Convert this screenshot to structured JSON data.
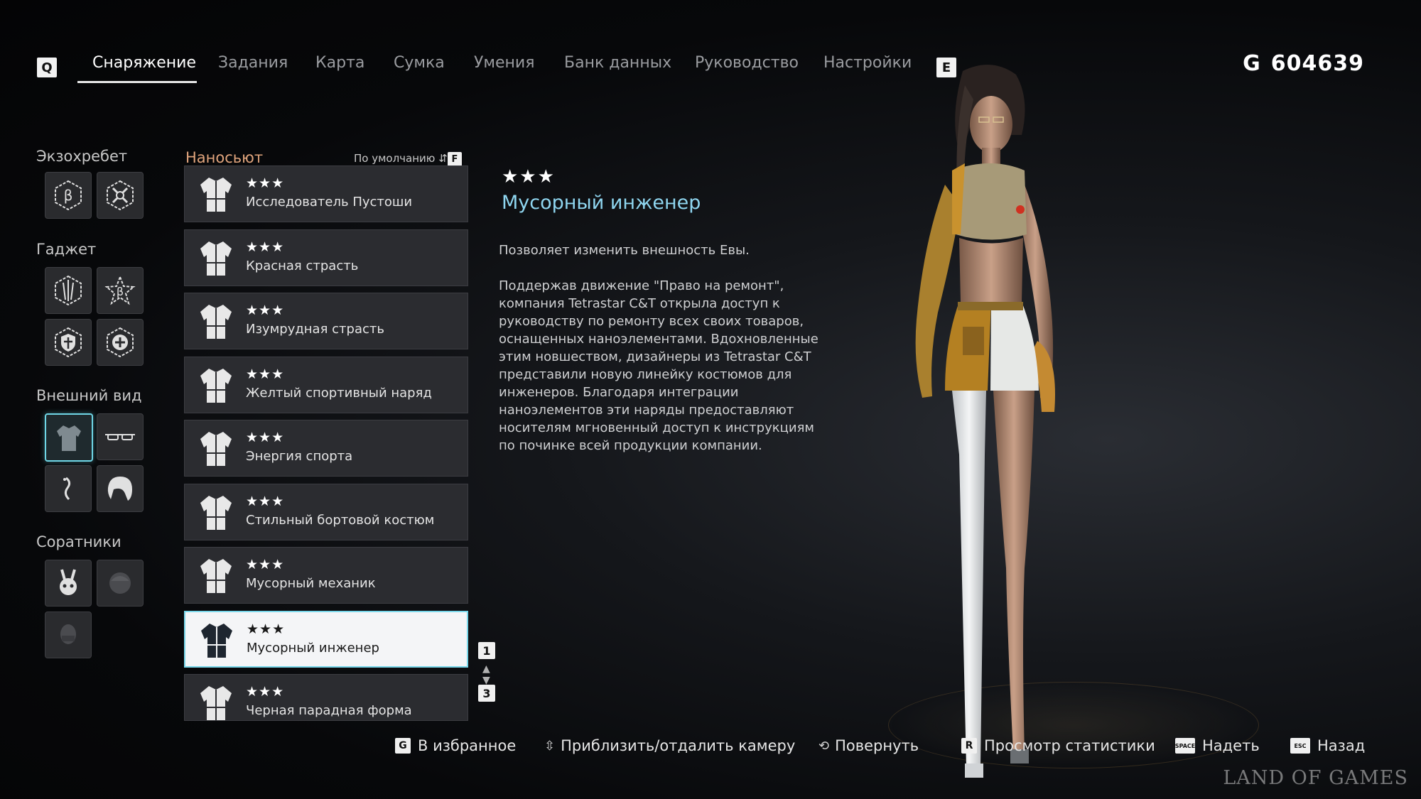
{
  "nav": {
    "prev_key": "Q",
    "next_key": "E",
    "tabs": [
      {
        "label": "Снаряжение"
      },
      {
        "label": "Задания"
      },
      {
        "label": "Карта"
      },
      {
        "label": "Сумка"
      },
      {
        "label": "Умения"
      },
      {
        "label": "Банк данных"
      },
      {
        "label": "Руководство"
      },
      {
        "label": "Настройки"
      }
    ],
    "active_tab": "Снаряжение"
  },
  "currency": {
    "symbol": "G",
    "amount": "604639"
  },
  "sidebar": {
    "exospine": "Экзохребет",
    "gadget": "Гаджет",
    "appearance": "Внешний вид",
    "companions": "Соратники"
  },
  "list": {
    "header": "Наносьют",
    "sort_label": "По умолчанию",
    "sort_key": "F",
    "items": [
      {
        "stars": "★★★",
        "name": "Исследователь Пустоши"
      },
      {
        "stars": "★★★",
        "name": "Красная страсть"
      },
      {
        "stars": "★★★",
        "name": "Изумрудная страсть"
      },
      {
        "stars": "★★★",
        "name": "Желтый спортивный наряд"
      },
      {
        "stars": "★★★",
        "name": "Энергия спорта"
      },
      {
        "stars": "★★★",
        "name": "Стильный бортовой костюм"
      },
      {
        "stars": "★★★",
        "name": "Мусорный механик"
      },
      {
        "stars": "★★★",
        "name": "Мусорный инженер"
      },
      {
        "stars": "★★★",
        "name": "Черная парадная форма"
      }
    ],
    "selected_index": 7,
    "page_key_top": "1",
    "page_key_bottom": "3"
  },
  "detail": {
    "stars": "★★★",
    "title": "Мусорный инженер",
    "paragraph1": "Позволяет изменить внешность Евы.",
    "paragraph2": "Поддержав движение \"Право на ремонт\", компания Tetrastar C&T открыла доступ к руководству по ремонту всех своих товаров, оснащенных наноэлементами. Вдохновленные этим новшеством, дизайнеры из Tetrastar C&T представили новую линейку костюмов для инженеров. Благодаря интеграции наноэлементов эти наряды предоставляют носителям мгновенный доступ к инструкциям по починке всей продукции компании."
  },
  "hints": {
    "favorite_key": "G",
    "favorite": "В избранное",
    "zoom": "Приблизить/отдалить камеру",
    "rotate": "Повернуть",
    "stats_key": "R",
    "stats": "Просмотр статистики",
    "equip_key": "SPACE",
    "equip": "Надеть",
    "back_key": "ESC",
    "back": "Назад"
  },
  "watermark": "LAND OF GAMES"
}
